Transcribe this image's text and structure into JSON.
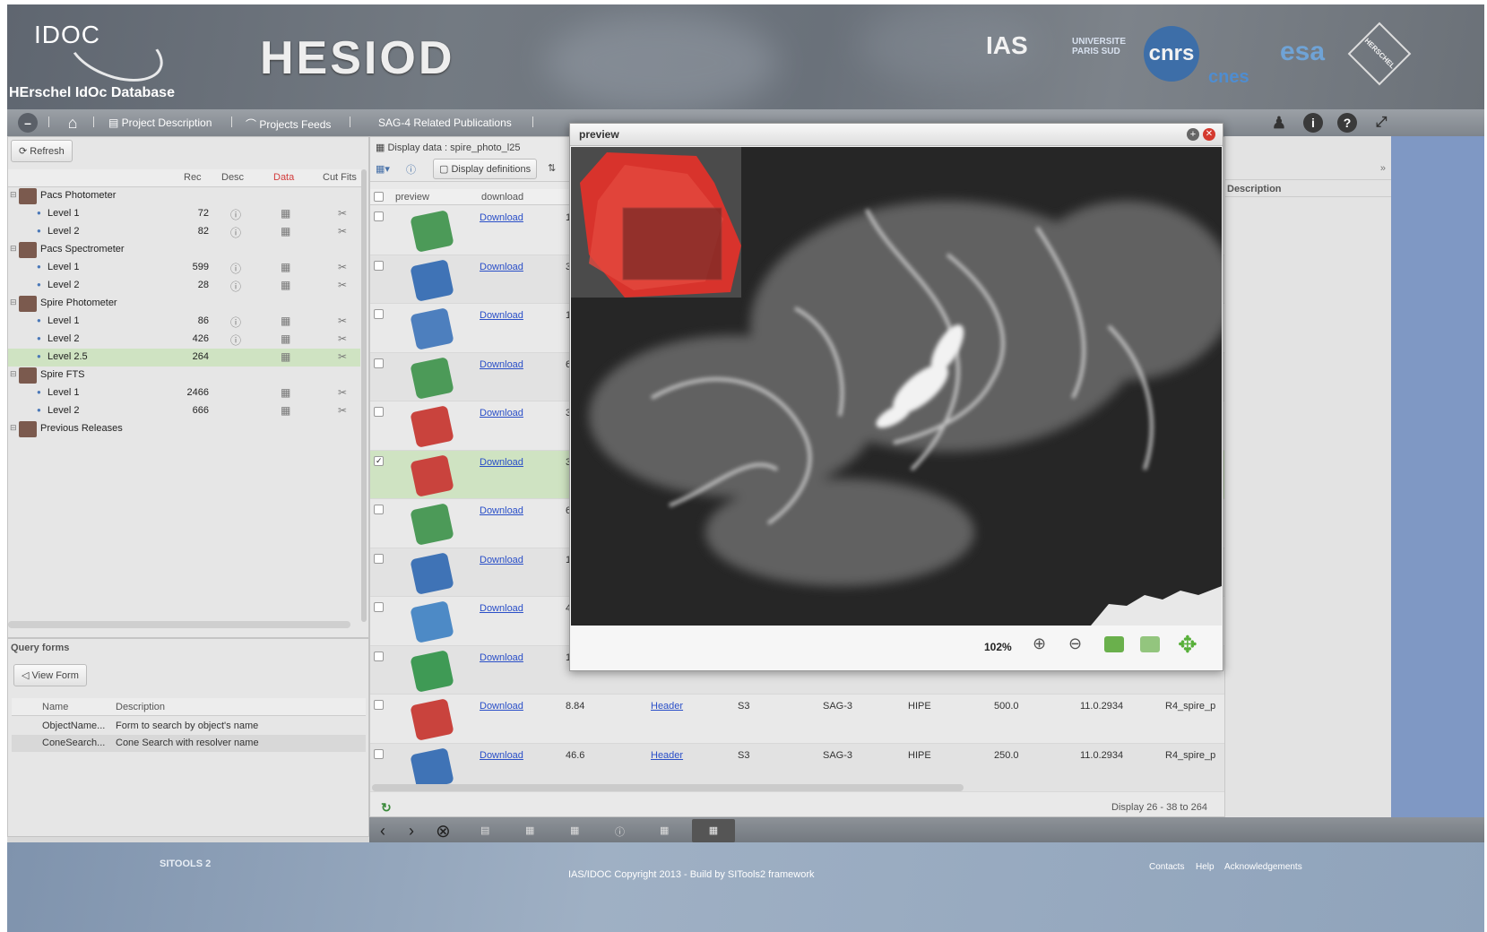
{
  "header": {
    "logo_text": "IDOC",
    "logo_sub": "HErschel IdOc Database",
    "app_name": "HESIOD",
    "partners": [
      "IAS",
      "UNIVERSITE PARIS SUD",
      "cnrs",
      "cnes",
      "esa",
      "HERSCHEL"
    ]
  },
  "toolbar": {
    "items": [
      "Project Description",
      "Projects Feeds",
      "SAG-4 Related Publications"
    ]
  },
  "left": {
    "refresh": "Refresh",
    "columns": [
      "Rec",
      "Desc",
      "Data",
      "Cut Fits"
    ],
    "tree": [
      {
        "label": "Pacs Photometer",
        "type": "group"
      },
      {
        "label": "Level 1",
        "rec": "72",
        "type": "leaf"
      },
      {
        "label": "Level 2",
        "rec": "82",
        "type": "leaf"
      },
      {
        "label": "Pacs Spectrometer",
        "type": "group"
      },
      {
        "label": "Level 1",
        "rec": "599",
        "type": "leaf"
      },
      {
        "label": "Level 2",
        "rec": "28",
        "type": "leaf"
      },
      {
        "label": "Spire Photometer",
        "type": "group"
      },
      {
        "label": "Level 1",
        "rec": "86",
        "type": "leaf"
      },
      {
        "label": "Level 2",
        "rec": "426",
        "type": "leaf"
      },
      {
        "label": "Level 2.5",
        "rec": "264",
        "type": "leaf",
        "selected": true
      },
      {
        "label": "Spire FTS",
        "type": "group"
      },
      {
        "label": "Level 1",
        "rec": "2466",
        "type": "leaf"
      },
      {
        "label": "Level 2",
        "rec": "666",
        "type": "leaf"
      },
      {
        "label": "Previous Releases",
        "type": "group"
      }
    ],
    "query_title": "Query forms",
    "view_form": "View Form",
    "query_columns": [
      "Name",
      "Description"
    ],
    "queries": [
      {
        "name": "ObjectName...",
        "desc": "Form to search by object's name"
      },
      {
        "name": "ConeSearch...",
        "desc": "Cone Search with resolver name"
      }
    ]
  },
  "display": {
    "title": "Display data : spire_photo_l25",
    "display_definitions": "Display definitions",
    "columns": [
      "preview",
      "download"
    ],
    "download_label": "Download",
    "thumb_colors": [
      "#4c9a58",
      "#3f73b6",
      "#4d7fbe",
      "#4c9a58",
      "#c9433d",
      "#c9433d",
      "#4c9a58",
      "#3f73b6",
      "#4d8ac6",
      "#3f9a55",
      "#c9433d",
      "#3f73b6"
    ],
    "checked_row": 5,
    "partial_values": [
      "1",
      "3",
      "1",
      "6",
      "3",
      "3",
      "6",
      "1",
      "4",
      "1"
    ],
    "full_rows": [
      {
        "value": "8.84",
        "header": "Header",
        "band": "S3",
        "sag": "SAG-3",
        "soft": "HIPE",
        "wave": "500.0",
        "ver": "11.0.2934",
        "file": "R4_spire_p"
      },
      {
        "value": "46.6",
        "header": "Header",
        "band": "S3",
        "sag": "SAG-3",
        "soft": "HIPE",
        "wave": "250.0",
        "ver": "11.0.2934",
        "file": "R4_spire_p"
      }
    ],
    "pager": "Display 26 - 38 to 264"
  },
  "preview": {
    "title": "preview",
    "zoom": "102%"
  },
  "right": {
    "description": "Description"
  },
  "footer": {
    "logo": "SITOOLS 2",
    "copyright": "IAS/IDOC Copyright 2013 - Build by SITools2 framework",
    "links": [
      "Contacts",
      "Help",
      "Acknowledgements"
    ]
  }
}
